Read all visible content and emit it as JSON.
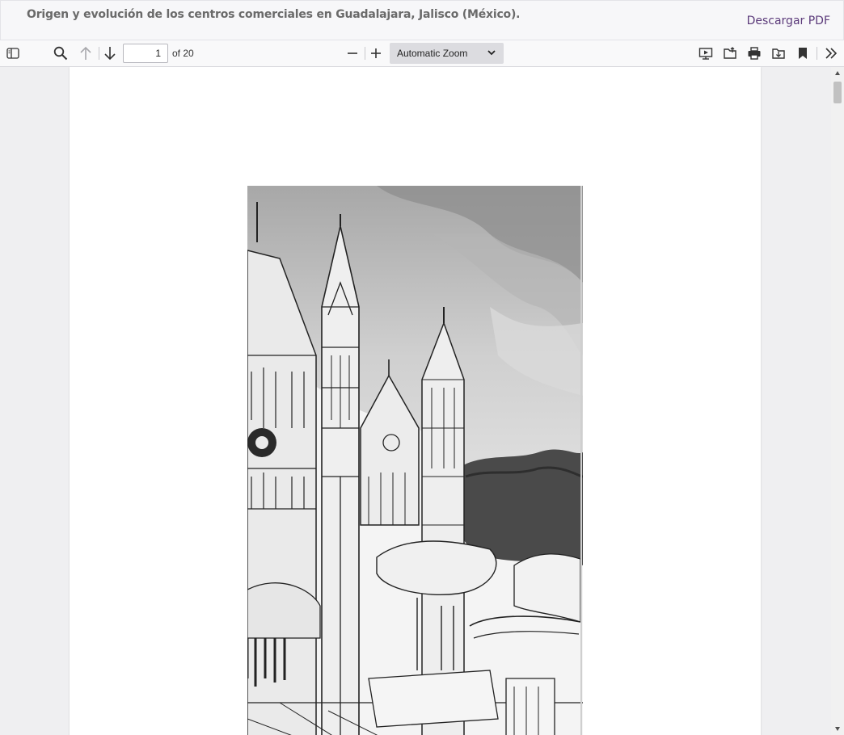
{
  "header": {
    "document_title": "Origen y evolución de los centros comerciales en Guadalajara, Jalisco (México).",
    "download_label": "Descargar PDF"
  },
  "toolbar": {
    "current_page": "1",
    "page_count_label": "of 20",
    "zoom_label": "Automatic Zoom",
    "icons": [
      "sidebar-toggle-icon",
      "search-icon",
      "previous-page-icon",
      "next-page-icon",
      "zoom-out-icon",
      "zoom-in-icon",
      "presentation-mode-icon",
      "open-file-icon",
      "print-icon",
      "download-icon",
      "bookmark-icon",
      "tools-menu-icon"
    ]
  },
  "colors": {
    "accent_link": "#5b3a7a",
    "toolbar_bg": "#f9f9fa",
    "viewer_bg": "#efeff1"
  }
}
